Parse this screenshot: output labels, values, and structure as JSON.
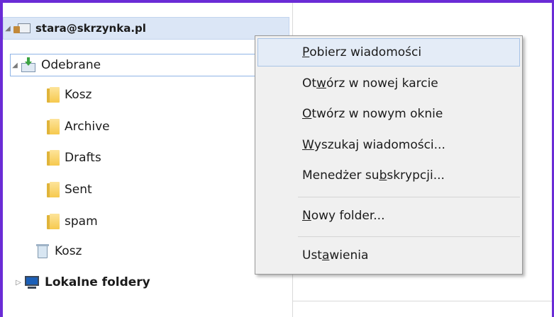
{
  "tree": {
    "account": {
      "label": "stara@skrzynka.pl",
      "twisty": "◢"
    },
    "inbox": {
      "label": "Odebrane",
      "twisty": "◢"
    },
    "subfolders": [
      {
        "label": "Kosz"
      },
      {
        "label": "Archive"
      },
      {
        "label": "Drafts"
      },
      {
        "label": "Sent"
      },
      {
        "label": "spam"
      }
    ],
    "trash": {
      "label": "Kosz"
    },
    "local": {
      "label": "Lokalne foldery",
      "twisty": "▷"
    }
  },
  "context_menu": {
    "items": [
      {
        "pre": "",
        "key": "P",
        "post": "obierz wiadomości"
      },
      {
        "pre": "Ot",
        "key": "w",
        "post": "órz w nowej karcie"
      },
      {
        "pre": "",
        "key": "O",
        "post": "twórz w nowym oknie"
      },
      {
        "pre": "",
        "key": "W",
        "post": "yszukaj wiadomości..."
      },
      {
        "pre": "Menedżer su",
        "key": "b",
        "post": "skrypcji..."
      },
      {
        "pre": "",
        "key": "N",
        "post": "owy folder..."
      },
      {
        "pre": "Ust",
        "key": "a",
        "post": "wienia"
      }
    ]
  },
  "colors": {
    "frame_border": "#6a2bd6",
    "selection_bg": "#dbe6f6",
    "menu_bg": "#f0f0f0",
    "menu_hover_bg": "#e4ecf7"
  }
}
